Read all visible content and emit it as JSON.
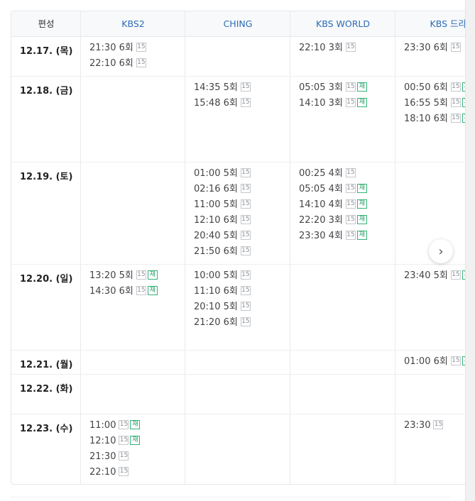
{
  "header": {
    "corner": "편성",
    "channels": [
      "KBS2",
      "CHING",
      "KBS WORLD",
      "KBS 드라마"
    ]
  },
  "badges": {
    "rating": "15",
    "rerun": "재"
  },
  "rows": [
    {
      "date": "12.17. (목)",
      "cells": [
        [
          {
            "text": "21:30 6회",
            "re": false
          },
          {
            "text": "22:10 6회",
            "re": false
          }
        ],
        [],
        [
          {
            "text": "22:10 3회",
            "re": false
          }
        ],
        [
          {
            "text": "23:30 6회",
            "re": false
          }
        ]
      ]
    },
    {
      "date": "12.18. (금)",
      "cells": [
        [],
        [
          {
            "text": "14:35 5회",
            "re": false
          },
          {
            "text": "15:48 6회",
            "re": false
          }
        ],
        [
          {
            "text": "05:05 3회",
            "re": true
          },
          {
            "text": "14:10 3회",
            "re": true
          }
        ],
        [
          {
            "text": "00:50 6회",
            "re": true
          },
          {
            "text": "16:55 5회",
            "re": true
          },
          {
            "text": "18:10 6회",
            "re": true
          }
        ]
      ]
    },
    {
      "date": "12.19. (토)",
      "cells": [
        [],
        [
          {
            "text": "01:00 5회",
            "re": false
          },
          {
            "text": "02:16 6회",
            "re": false
          },
          {
            "text": "11:00 5회",
            "re": false
          },
          {
            "text": "12:10 6회",
            "re": false
          },
          {
            "text": "20:40 5회",
            "re": false
          },
          {
            "text": "21:50 6회",
            "re": false
          }
        ],
        [
          {
            "text": "00:25 4회",
            "re": false
          },
          {
            "text": "05:05 4회",
            "re": true
          },
          {
            "text": "14:10 4회",
            "re": true
          },
          {
            "text": "22:20 3회",
            "re": true
          },
          {
            "text": "23:30 4회",
            "re": true
          }
        ],
        []
      ]
    },
    {
      "date": "12.20. (일)",
      "cells": [
        [
          {
            "text": "13:20 5회",
            "re": true
          },
          {
            "text": "14:30 6회",
            "re": true
          }
        ],
        [
          {
            "text": "10:00 5회",
            "re": false
          },
          {
            "text": "11:10 6회",
            "re": false
          },
          {
            "text": "20:10 5회",
            "re": false
          },
          {
            "text": "21:20 6회",
            "re": false
          }
        ],
        [],
        [
          {
            "text": "23:40 5회",
            "re": true
          }
        ]
      ]
    },
    {
      "date": "12.21. (월)",
      "cells": [
        [],
        [],
        [],
        [
          {
            "text": "01:00 6회",
            "re": true
          }
        ]
      ]
    },
    {
      "date": "12.22. (화)",
      "cells": [
        [],
        [],
        [],
        []
      ]
    },
    {
      "date": "12.23. (수)",
      "cells": [
        [
          {
            "text": "11:00",
            "re": true
          },
          {
            "text": "12:10",
            "re": true
          },
          {
            "text": "21:30",
            "re": false
          },
          {
            "text": "22:10",
            "re": false
          }
        ],
        [],
        [],
        [
          {
            "text": "23:30",
            "re": false
          }
        ]
      ]
    }
  ]
}
